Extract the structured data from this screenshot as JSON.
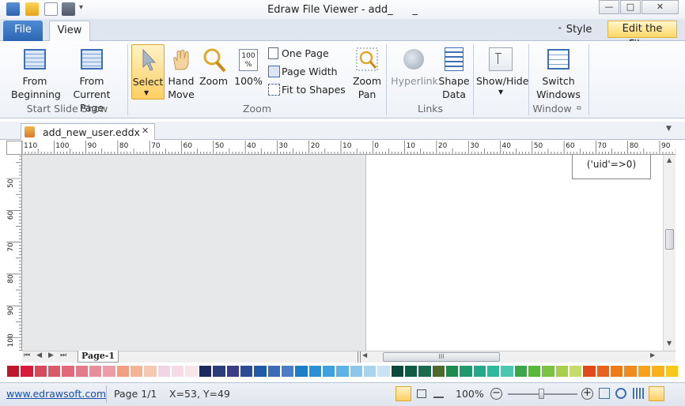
{
  "app": {
    "title": "Edraw File Viewer - add_",
    "title_suffix": "_",
    "win_min": "—",
    "win_max": "□",
    "win_close": "✕"
  },
  "ribbon_tabs": {
    "file": "File",
    "view": "View"
  },
  "ribbon_right": {
    "style": "Style",
    "edit": "Edit the File..."
  },
  "ribbon": {
    "from_beginning": [
      "From",
      "Beginning"
    ],
    "from_current": [
      "From",
      "Current Page"
    ],
    "group_slideshow": "Start Slide Show",
    "select": "Select",
    "hand_move": [
      "Hand",
      "Move"
    ],
    "zoom": "Zoom",
    "zoom_100": "100%",
    "one_page": "One Page",
    "page_width": "Page Width",
    "fit_to_shapes": "Fit to Shapes",
    "zoom_pan": [
      "Zoom",
      "Pan"
    ],
    "group_zoom": "Zoom",
    "hyperlink": "Hyperlink",
    "shape_data": [
      "Shape",
      "Data"
    ],
    "group_links": "Links",
    "show_hide": "Show/Hide",
    "switch_windows": [
      "Switch",
      "Windows"
    ],
    "group_window": "Window"
  },
  "document_tab": {
    "label": "add_new_user.eddx",
    "close": "✕"
  },
  "ruler": {
    "h_labels": [
      "110",
      "100",
      "90",
      "80",
      "70",
      "60",
      "50",
      "40",
      "30",
      "20",
      "10",
      "0",
      "10",
      "20",
      "30",
      "40",
      "50",
      "60",
      "70",
      "80",
      "90"
    ],
    "v_labels": [
      "50",
      "60",
      "70",
      "80",
      "90",
      "100"
    ]
  },
  "canvas": {
    "shape_text": "('uid'=>0)"
  },
  "page_tabs": {
    "page": "Page-1"
  },
  "status": {
    "website": "www.edrawsoft.com",
    "page": "Page 1/1",
    "coords": "X=53, Y=49",
    "zoom": "100%"
  },
  "palette": [
    "#c0182b",
    "#d91a3a",
    "#d44b5c",
    "#d95b6b",
    "#e16a7a",
    "#e47b8b",
    "#e98d9a",
    "#ed9fa8",
    "#f0a080",
    "#f3b596",
    "#f5c9b0",
    "#efd4e4",
    "#f6dbe7",
    "#f9e4ea",
    "#1d2a60",
    "#2a3d7a",
    "#3b3b8a",
    "#2c4b92",
    "#1f5ba7",
    "#3d6cb6",
    "#4a7dc4",
    "#1b7fc8",
    "#2b90d6",
    "#3fa0de",
    "#5fb2e6",
    "#8bc6ec",
    "#a8d4f0",
    "#c9e3f4",
    "#0a4a3a",
    "#0f5b44",
    "#1b6c4c",
    "#4c6a2a",
    "#1e8a4d",
    "#22996a",
    "#23a98a",
    "#2fb89c",
    "#4dc6ae",
    "#3aa84a",
    "#58b83c",
    "#7cc243",
    "#a6d04a",
    "#c6dc6a",
    "#e04a1c",
    "#e8621b",
    "#ef7a1a",
    "#f08b20",
    "#f5a21d",
    "#f7b21b",
    "#f7c81b"
  ]
}
